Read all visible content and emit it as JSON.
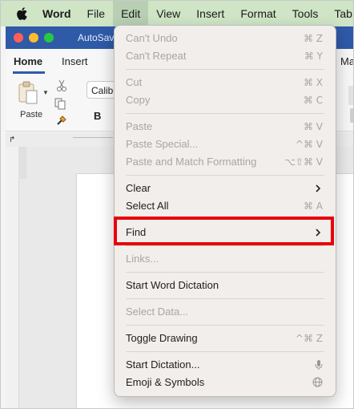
{
  "menubar": {
    "app": "Word",
    "items": [
      "File",
      "Edit",
      "View",
      "Insert",
      "Format",
      "Tools",
      "Tab"
    ]
  },
  "window": {
    "title": "AutoSav"
  },
  "ribbon": {
    "tabs": [
      "Home",
      "Insert",
      "Ma"
    ],
    "paste_label": "Paste",
    "font_name": "Calib",
    "bold_label": "B"
  },
  "edit_menu": {
    "items": [
      {
        "label": "Can't Undo",
        "shortcut": "⌘ Z"
      },
      {
        "label": "Can't Repeat",
        "shortcut": "⌘ Y"
      },
      {
        "label": "Cut",
        "shortcut": "⌘ X"
      },
      {
        "label": "Copy",
        "shortcut": "⌘ C"
      },
      {
        "label": "Paste",
        "shortcut": "⌘ V"
      },
      {
        "label": "Paste Special...",
        "shortcut": "^⌘ V"
      },
      {
        "label": "Paste and Match Formatting",
        "shortcut": "⌥⇧⌘ V"
      },
      {
        "label": "Clear",
        "shortcut": ""
      },
      {
        "label": "Select All",
        "shortcut": "⌘ A"
      },
      {
        "label": "Find",
        "shortcut": ""
      },
      {
        "label": "Links...",
        "shortcut": ""
      },
      {
        "label": "Start Word Dictation",
        "shortcut": ""
      },
      {
        "label": "Select Data...",
        "shortcut": ""
      },
      {
        "label": "Toggle Drawing",
        "shortcut": "^⌘ Z"
      },
      {
        "label": "Start Dictation...",
        "shortcut": ""
      },
      {
        "label": "Emoji & Symbols",
        "shortcut": ""
      }
    ]
  },
  "colors": {
    "highlight_border": "#e8000c",
    "menubar_bg": "#cfe5c6",
    "titlebar_bg": "#2f5aa8"
  },
  "icons": [
    "apple-icon",
    "chevron-right-icon",
    "microphone-icon",
    "globe-icon"
  ]
}
